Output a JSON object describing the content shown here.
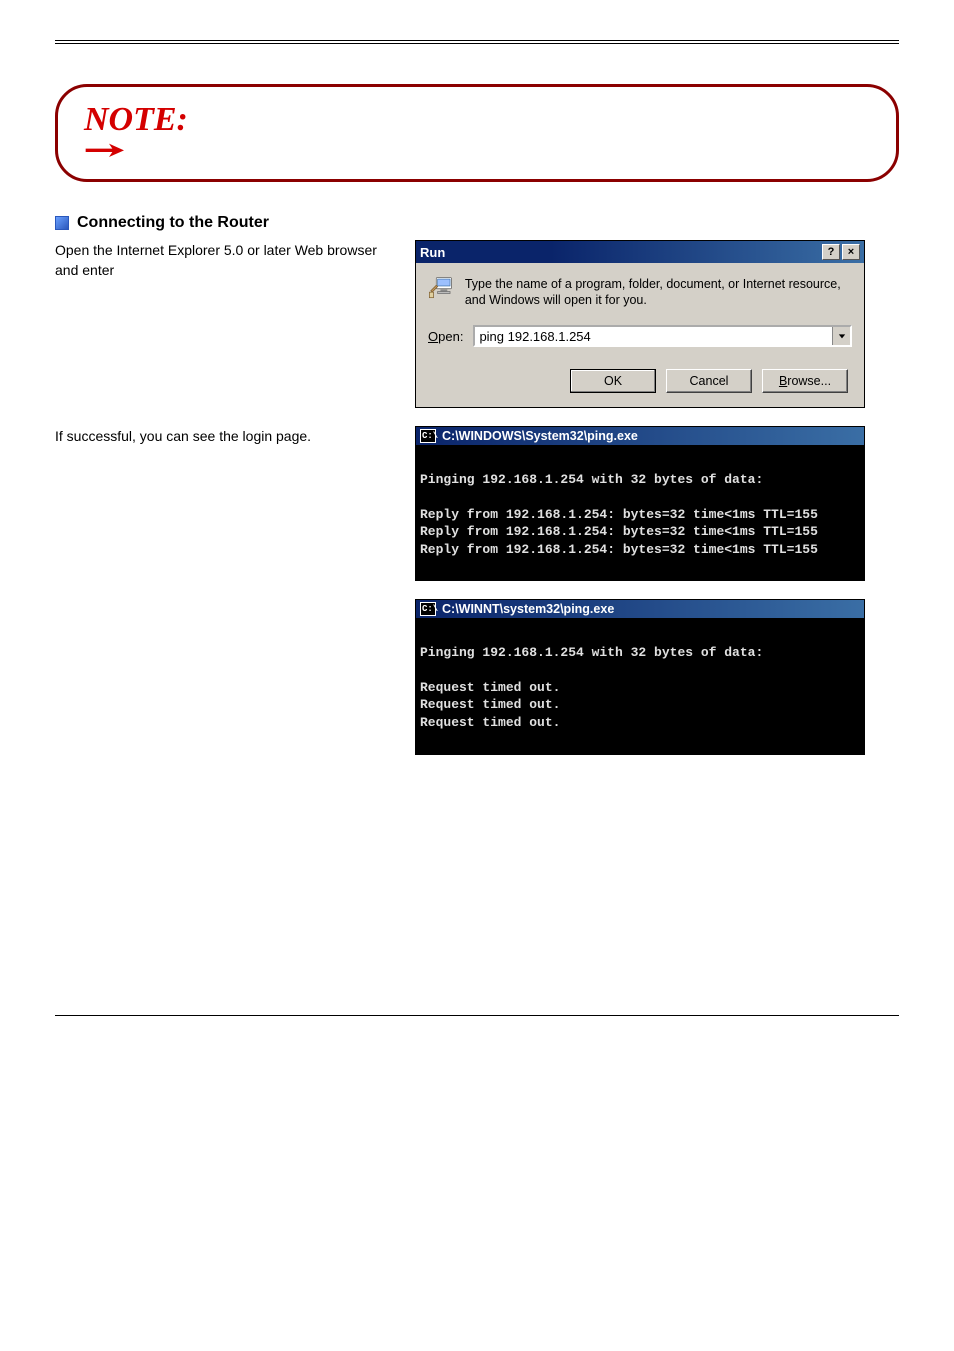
{
  "note": {
    "label": "NOTE:"
  },
  "section": {
    "title": "Connecting to the Router"
  },
  "instruction": {
    "step1": "Open the Internet Explorer 5.0 or later Web browser and enter",
    "step2": "If successful, you can see the login page."
  },
  "run_dialog": {
    "title": "Run",
    "description": "Type the name of a program, folder, document, or Internet resource, and Windows will open it for you.",
    "open_label": "Open:",
    "open_value": "ping 192.168.1.254",
    "ok": "OK",
    "cancel": "Cancel",
    "browse": "Browse..."
  },
  "console1": {
    "title": "C:\\WINDOWS\\System32\\ping.exe",
    "body": "\nPinging 192.168.1.254 with 32 bytes of data:\n\nReply from 192.168.1.254: bytes=32 time<1ms TTL=155\nReply from 192.168.1.254: bytes=32 time<1ms TTL=155\nReply from 192.168.1.254: bytes=32 time<1ms TTL=155"
  },
  "console2": {
    "title": "C:\\WINNT\\system32\\ping.exe",
    "body": "\nPinging 192.168.1.254 with 32 bytes of data:\n\nRequest timed out.\nRequest timed out.\nRequest timed out."
  }
}
